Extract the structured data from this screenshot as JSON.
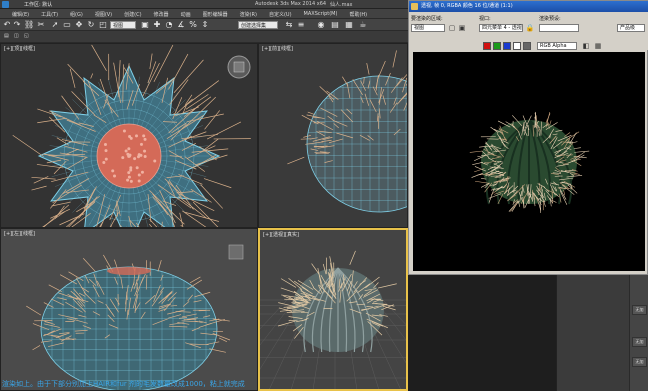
{
  "titlebar": {
    "project": "工作区: 默认",
    "app_title": "Autodesk 3ds Max  2014 x64",
    "file_name": "仙人.max"
  },
  "menubar": {
    "items": [
      "编辑(E)",
      "工具(T)",
      "组(G)",
      "视图(V)",
      "创建(C)",
      "修改器",
      "动画",
      "图形编辑器",
      "渲染(R)",
      "自定义(U)",
      "MAXScript(M)",
      "帮助(H)"
    ]
  },
  "toolbar": {
    "view_select": "视图",
    "create_selection_set": "创建选择集"
  },
  "viewports": {
    "top_label": "[+][顶][线框]",
    "front_label": "[+][前][线框]",
    "left_label": "[+][左][线框]",
    "persp_label": "[+][透视][真实]"
  },
  "render_frame": {
    "title": "透视, 帧 0, RGBA 颜色 16 位/通道 (1:1)",
    "area_to_render_label": "要渲染的区域:",
    "area_to_render_value": "视图",
    "viewport_label": "视口:",
    "viewport_value": "四元菜单 4 - 透视",
    "preset_label": "渲染预设:",
    "renderer_value": "产品级",
    "channel_value": "RGB Alpha",
    "swatch_colors": [
      "#d01010",
      "#1a9a1a",
      "#1a3ad0",
      "#ffffff",
      "#666666"
    ]
  },
  "right_strip": {
    "buttons": [
      "无加",
      "无加",
      "无加"
    ]
  },
  "caption": {
    "text": "渲染如上。由于下部分别加上HAIR和fur 剂的毛发数量改成1000，粘上就完成"
  },
  "colors": {
    "spine": "#d9b08a",
    "wire_blue": "#7fd0e8",
    "core": "#d46a58",
    "body_green": "#2a4a30",
    "accent_yellow": "#e8c24a"
  }
}
